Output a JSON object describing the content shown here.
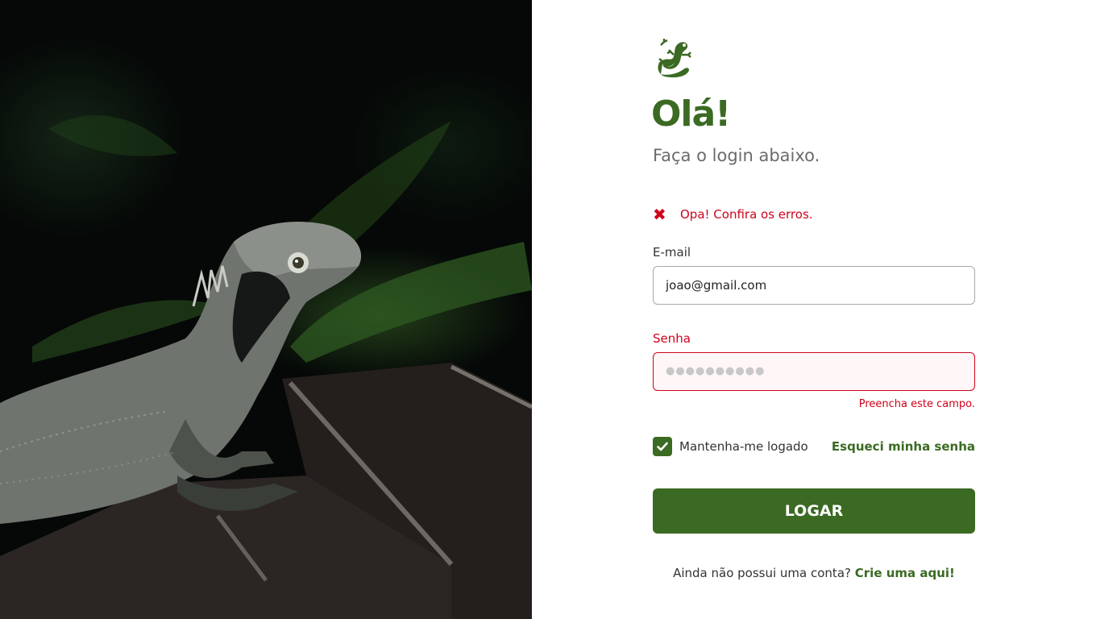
{
  "hero_image": {
    "icon": "lizard-photo",
    "colors": {
      "background": "#050807",
      "leaf": "#2f5a22",
      "lizard": "#6f756e",
      "brick": "#2b2624"
    }
  },
  "brand": {
    "logo_icon": "gecko-icon",
    "color": "#3b6a23"
  },
  "header": {
    "title": "Olá!",
    "subtitle": "Faça o login abaixo."
  },
  "alert": {
    "icon": "error-x-icon",
    "message": "Opa! Confira os erros.",
    "color": "#d0021b"
  },
  "form": {
    "email": {
      "label": "E-mail",
      "value": "joao@gmail.com",
      "placeholder": ""
    },
    "password": {
      "label": "Senha",
      "placeholder_dots": "●●●●●●●●●●",
      "error": "Preencha este campo."
    },
    "remember": {
      "label": "Mantenha-me logado",
      "checked": true
    },
    "forgot_link": "Esqueci minha senha",
    "submit_label": "LOGAR"
  },
  "signup": {
    "prompt": "Ainda não possui uma conta?",
    "link": "Crie uma aqui!"
  }
}
